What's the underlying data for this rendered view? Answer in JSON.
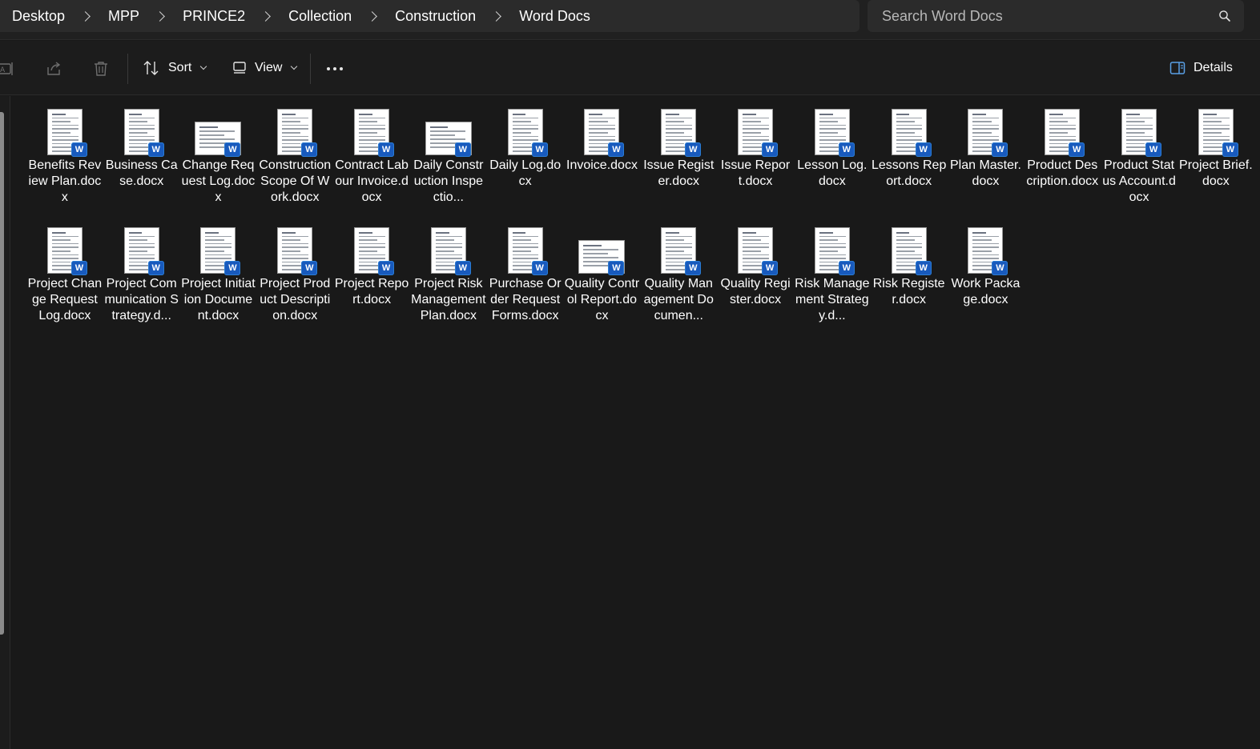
{
  "breadcrumb": [
    "Desktop",
    "MPP",
    "PRINCE2",
    "Collection",
    "Construction",
    "Word Docs"
  ],
  "search": {
    "placeholder": "Search Word Docs"
  },
  "toolbar": {
    "sort_label": "Sort",
    "view_label": "View",
    "details_label": "Details",
    "icons": [
      "rename-icon",
      "share-icon",
      "delete-icon",
      "sort-icon",
      "view-icon",
      "more-icon",
      "details-pane-icon"
    ]
  },
  "files": [
    {
      "name": "Benefits Review Plan.docx",
      "orientation": "portrait"
    },
    {
      "name": "Business Case.docx",
      "orientation": "portrait"
    },
    {
      "name": "Change Request Log.docx",
      "orientation": "landscape"
    },
    {
      "name": "Construction Scope Of Work.docx",
      "orientation": "portrait"
    },
    {
      "name": "Contract Labour Invoice.docx",
      "orientation": "portrait"
    },
    {
      "name": "Daily Construction Inspectio...",
      "orientation": "landscape"
    },
    {
      "name": "Daily Log.docx",
      "orientation": "portrait"
    },
    {
      "name": "Invoice.docx",
      "orientation": "portrait"
    },
    {
      "name": "Issue Register.docx",
      "orientation": "portrait"
    },
    {
      "name": "Issue Report.docx",
      "orientation": "portrait"
    },
    {
      "name": "Lesson Log.docx",
      "orientation": "portrait"
    },
    {
      "name": "Lessons Report.docx",
      "orientation": "portrait"
    },
    {
      "name": "Plan Master.docx",
      "orientation": "portrait"
    },
    {
      "name": "Product Description.docx",
      "orientation": "portrait"
    },
    {
      "name": "Product Status Account.docx",
      "orientation": "portrait"
    },
    {
      "name": "Project Brief.docx",
      "orientation": "portrait"
    },
    {
      "name": "Project Change Request Log.docx",
      "orientation": "portrait"
    },
    {
      "name": "Project Communication Strategy.d...",
      "orientation": "portrait"
    },
    {
      "name": "Project Initiation Document.docx",
      "orientation": "portrait"
    },
    {
      "name": "Project Product Description.docx",
      "orientation": "portrait"
    },
    {
      "name": "Project Report.docx",
      "orientation": "portrait"
    },
    {
      "name": "Project Risk Management Plan.docx",
      "orientation": "portrait"
    },
    {
      "name": "Purchase Order Request Forms.docx",
      "orientation": "portrait"
    },
    {
      "name": "Quality Control Report.docx",
      "orientation": "landscape"
    },
    {
      "name": "Quality Management Documen...",
      "orientation": "portrait"
    },
    {
      "name": "Quality Register.docx",
      "orientation": "portrait"
    },
    {
      "name": "Risk Management Strategy.d...",
      "orientation": "portrait"
    },
    {
      "name": "Risk Register.docx",
      "orientation": "portrait"
    },
    {
      "name": "Work Package.docx",
      "orientation": "portrait"
    }
  ],
  "badge_letter": "W",
  "colors": {
    "background": "#191919",
    "word_badge": "#185abd",
    "surface": "#2b2b2b"
  }
}
